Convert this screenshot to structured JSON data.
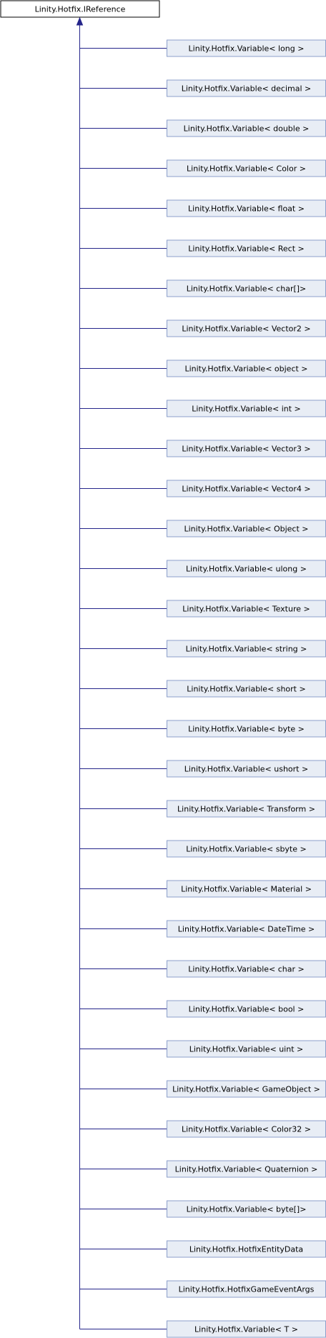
{
  "colors": {
    "edge": "#25258a",
    "root_fill": "#ffffff",
    "root_border": "#000000",
    "child_fill": "#e8edf5",
    "child_border": "#8c9fcb"
  },
  "root": {
    "label": "Linity.Hotfix.IReference"
  },
  "children": [
    {
      "label": "Linity.Hotfix.Variable< long >"
    },
    {
      "label": "Linity.Hotfix.Variable< decimal >"
    },
    {
      "label": "Linity.Hotfix.Variable< double >"
    },
    {
      "label": "Linity.Hotfix.Variable< Color >"
    },
    {
      "label": "Linity.Hotfix.Variable< float >"
    },
    {
      "label": "Linity.Hotfix.Variable< Rect >"
    },
    {
      "label": "Linity.Hotfix.Variable< char[]>"
    },
    {
      "label": "Linity.Hotfix.Variable< Vector2 >"
    },
    {
      "label": "Linity.Hotfix.Variable< object >"
    },
    {
      "label": "Linity.Hotfix.Variable< int >"
    },
    {
      "label": "Linity.Hotfix.Variable< Vector3 >"
    },
    {
      "label": "Linity.Hotfix.Variable< Vector4 >"
    },
    {
      "label": "Linity.Hotfix.Variable< Object >"
    },
    {
      "label": "Linity.Hotfix.Variable< ulong >"
    },
    {
      "label": "Linity.Hotfix.Variable< Texture >"
    },
    {
      "label": "Linity.Hotfix.Variable< string >"
    },
    {
      "label": "Linity.Hotfix.Variable< short >"
    },
    {
      "label": "Linity.Hotfix.Variable< byte >"
    },
    {
      "label": "Linity.Hotfix.Variable< ushort >"
    },
    {
      "label": "Linity.Hotfix.Variable< Transform >"
    },
    {
      "label": "Linity.Hotfix.Variable< sbyte >"
    },
    {
      "label": "Linity.Hotfix.Variable< Material >"
    },
    {
      "label": "Linity.Hotfix.Variable< DateTime >"
    },
    {
      "label": "Linity.Hotfix.Variable< char >"
    },
    {
      "label": "Linity.Hotfix.Variable< bool >"
    },
    {
      "label": "Linity.Hotfix.Variable< uint >"
    },
    {
      "label": "Linity.Hotfix.Variable< GameObject >"
    },
    {
      "label": "Linity.Hotfix.Variable< Color32 >"
    },
    {
      "label": "Linity.Hotfix.Variable< Quaternion >"
    },
    {
      "label": "Linity.Hotfix.Variable< byte[]>"
    },
    {
      "label": "Linity.Hotfix.HotfixEntityData"
    },
    {
      "label": "Linity.Hotfix.HotfixGameEventArgs"
    },
    {
      "label": "Linity.Hotfix.Variable< T >"
    }
  ]
}
